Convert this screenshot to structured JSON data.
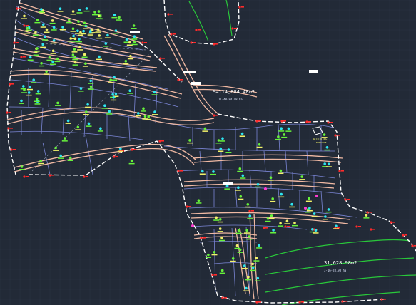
{
  "drawing": {
    "area_label_1": "S=114,884.48m2.",
    "area_label_1_sub": "11-48-84.48 ha",
    "area_label_2": "31,628.98m2",
    "area_label_2_sub": "3-16-28.98 ha",
    "building_label": "BUILDING",
    "building_label_sub": "ENTRANCE"
  },
  "colors": {
    "background": "#222a37",
    "grid": "#2c3544",
    "lot_lines": "#7b86d6",
    "road": "#f0b9a3",
    "boundary": "#ffffff",
    "boundary_marker": "#ff2a2a",
    "contour": "#29c83a",
    "lot_marker_cyan": "#2ee6f0",
    "lot_marker_green": "#67f23b",
    "lot_marker_yellow": "#f2f26a",
    "lot_marker_magenta": "#ff3cd2"
  }
}
